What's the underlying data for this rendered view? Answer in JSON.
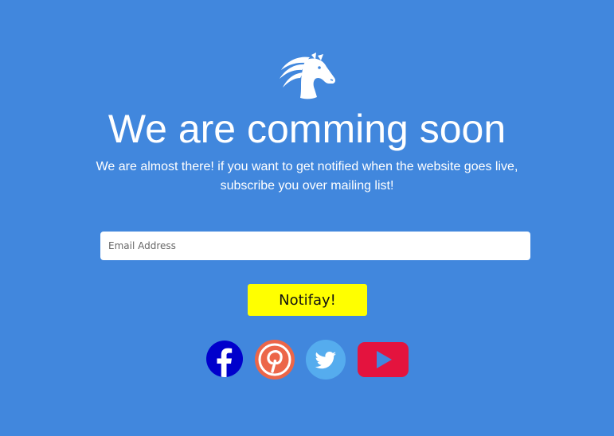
{
  "hero": {
    "title": "We are comming soon",
    "subtitle_line1": "We are almost there! if you want to get notified when the website goes live,",
    "subtitle_line2": "subscribe you over mailing list!"
  },
  "form": {
    "email_placeholder": "Email Address",
    "email_value": "",
    "submit_label": "Notifay!"
  },
  "social": {
    "facebook": {
      "icon": "facebook-icon",
      "color": "#0000cc"
    },
    "pinterest": {
      "icon": "pinterest-icon",
      "color": "#ec6649"
    },
    "twitter": {
      "icon": "twitter-icon",
      "color": "#55acee"
    },
    "youtube": {
      "icon": "youtube-icon",
      "color": "#e4133e"
    }
  },
  "colors": {
    "background": "#4187dd",
    "button": "#ffff00"
  }
}
